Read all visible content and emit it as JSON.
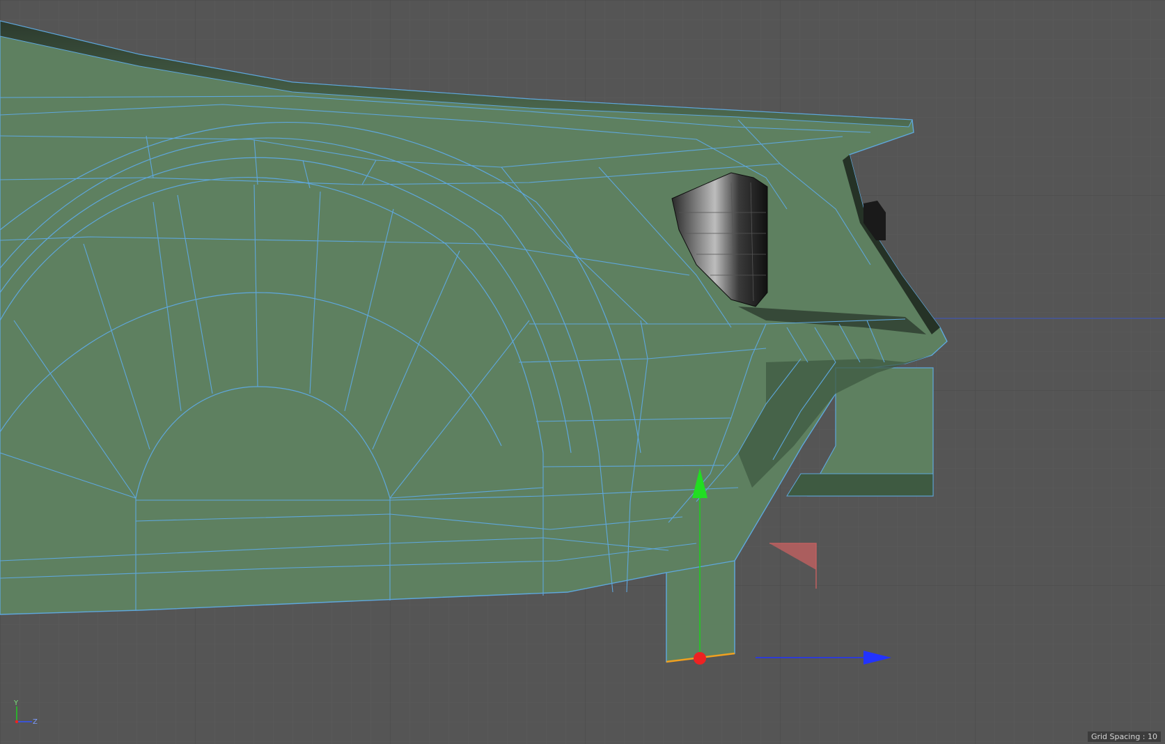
{
  "viewport": {
    "status": {
      "label": "Grid Spacing : 10"
    },
    "axis_indicator": {
      "y": "Y",
      "z": "Z"
    }
  },
  "colors": {
    "background": "#555555",
    "grid": "#5d5d5d",
    "mesh_fill": "#5e8060",
    "wireframe": "#5ea7dc",
    "horizon": "#3a56c4",
    "gizmo_y": "#22cc22",
    "gizmo_z": "#2233ff",
    "gizmo_origin": "#ee2222",
    "gizmo_plane": "#c06060",
    "selected_edge": "#f0a020",
    "grille": "#1a1a1a"
  },
  "icons": {
    "move_gizmo": "move-arrows-icon",
    "plane_handle": "plane-handle-icon",
    "axis_indicator": "axis-triad-icon"
  }
}
